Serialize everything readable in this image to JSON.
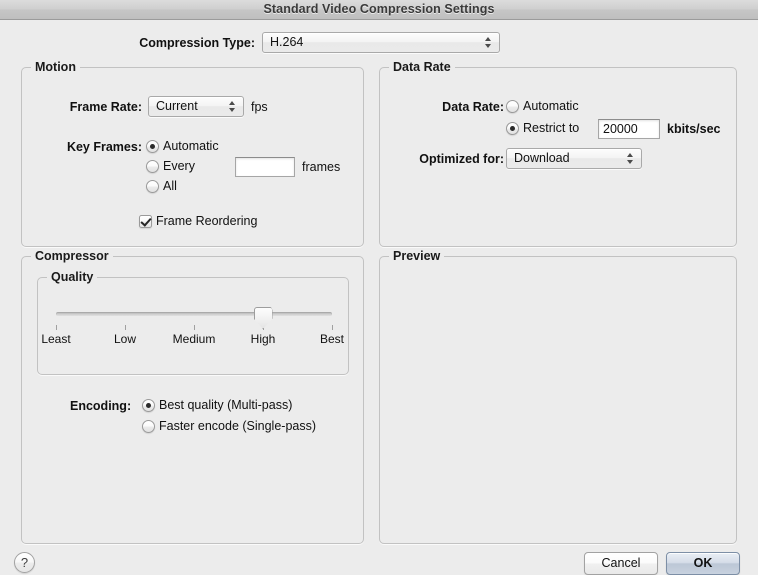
{
  "window": {
    "title": "Standard Video Compression Settings"
  },
  "compression_type": {
    "label": "Compression Type:",
    "value": "H.264"
  },
  "motion": {
    "title": "Motion",
    "frame_rate": {
      "label": "Frame Rate:",
      "value": "Current",
      "unit": "fps"
    },
    "key_frames": {
      "label": "Key Frames:",
      "options": [
        {
          "label": "Automatic",
          "selected": true
        },
        {
          "label": "Every",
          "selected": false
        },
        {
          "label": "All",
          "selected": false
        }
      ],
      "every_value": "",
      "every_unit": "frames"
    },
    "frame_reordering": {
      "label": "Frame Reordering",
      "checked": true
    }
  },
  "data_rate": {
    "title": "Data Rate",
    "label": "Data Rate:",
    "options": [
      {
        "label": "Automatic",
        "selected": false
      },
      {
        "label": "Restrict to",
        "selected": true
      }
    ],
    "restrict_value": "20000",
    "restrict_unit": "kbits/sec",
    "optimized_for": {
      "label": "Optimized for:",
      "value": "Download"
    }
  },
  "compressor": {
    "title": "Compressor",
    "quality": {
      "title": "Quality",
      "ticks": [
        "Least",
        "Low",
        "Medium",
        "High",
        "Best"
      ],
      "selected": "High",
      "selected_index": 3
    },
    "encoding": {
      "label": "Encoding:",
      "options": [
        {
          "label": "Best quality (Multi-pass)",
          "selected": true
        },
        {
          "label": "Faster encode (Single-pass)",
          "selected": false
        }
      ]
    }
  },
  "preview": {
    "title": "Preview"
  },
  "footer": {
    "help_label": "?",
    "cancel_label": "Cancel",
    "ok_label": "OK"
  }
}
